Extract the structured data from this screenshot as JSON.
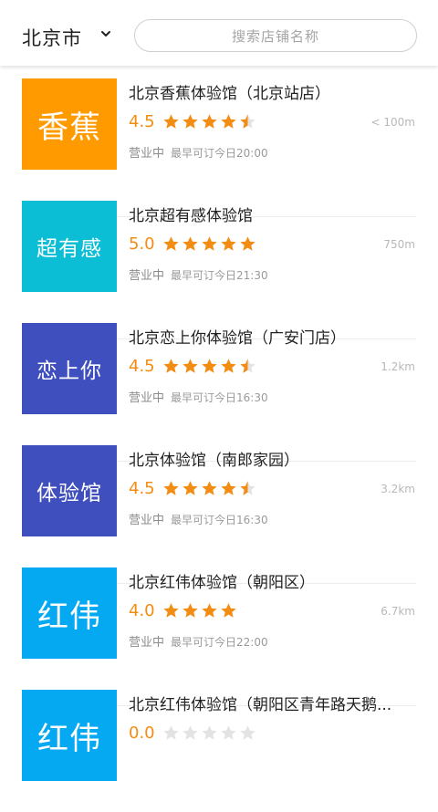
{
  "header": {
    "city": "北京市",
    "city_dropdown_icon": "chevron-down-icon",
    "search_placeholder": "搜索店铺名称"
  },
  "colors": {
    "accent": "#f28c12",
    "star_filled": "#f28c12",
    "star_empty": "#e3e3e3"
  },
  "stores": [
    {
      "thumb_text": "香蕉",
      "thumb_color": "#ff9a00",
      "name": "北京香蕉体验馆（北京站店）",
      "score": "4.5",
      "stars": 4.5,
      "distance": "< 100m",
      "status": "营业中",
      "hours": "最早可订今日20:00"
    },
    {
      "thumb_text": "超有感",
      "thumb_color": "#0bbed6",
      "name": "北京超有感体验馆",
      "score": "5.0",
      "stars": 5,
      "distance": "750m",
      "status": "营业中",
      "hours": "最早可订今日21:30"
    },
    {
      "thumb_text": "恋上你",
      "thumb_color": "#3f4fbd",
      "name": "北京恋上你体验馆（广安门店）",
      "score": "4.5",
      "stars": 4.5,
      "distance": "1.2km",
      "status": "营业中",
      "hours": "最早可订今日16:30"
    },
    {
      "thumb_text": "体验馆",
      "thumb_color": "#3f4fbd",
      "name": "北京体验馆（南郎家园）",
      "score": "4.5",
      "stars": 4.5,
      "distance": "3.2km",
      "status": "营业中",
      "hours": "最早可订今日16:30"
    },
    {
      "thumb_text": "红伟",
      "thumb_color": "#05a9f2",
      "name": "北京红伟体验馆（朝阳区）",
      "score": "4.0",
      "stars": 4,
      "distance": "6.7km",
      "status": "营业中",
      "hours": "最早可订今日22:00"
    },
    {
      "thumb_text": "红伟",
      "thumb_color": "#05a9f2",
      "name": "北京红伟体验馆（朝阳区青年路天鹅...",
      "score": "0.0",
      "stars": 0,
      "distance": "",
      "status": "",
      "hours": ""
    }
  ]
}
